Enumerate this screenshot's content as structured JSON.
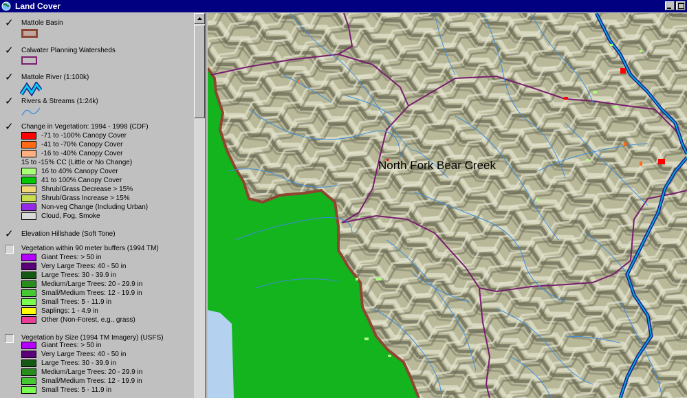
{
  "window": {
    "title": "Land Cover"
  },
  "toc": {
    "layers": [
      {
        "name": "Mattole Basin",
        "checked": true
      },
      {
        "name": "Calwater Planning Watersheds",
        "checked": true
      },
      {
        "name": "Mattole River (1:100k)",
        "checked": true
      },
      {
        "name": "Rivers & Streams (1:24k)",
        "checked": true
      },
      {
        "name": "Change in Vegetation: 1994 - 1998 (CDF)",
        "checked": true,
        "legend": [
          {
            "label": "-71 to -100% Canopy Cover",
            "color": "#ff0000"
          },
          {
            "label": "-41 to -70% Canopy Cover",
            "color": "#ff6a14"
          },
          {
            "label": "-16 to -40% Canopy Cover",
            "color": "#ffb080"
          },
          {
            "label": "15 to -15% CC (Little or No Change)",
            "color": null
          },
          {
            "label": "16 to 40% Canopy Cover",
            "color": "#a8ff78"
          },
          {
            "label": "41 to 100% Canopy Cover",
            "color": "#00c800"
          },
          {
            "label": "Shrub/Grass Decrease > 15%",
            "color": "#f0d878"
          },
          {
            "label": "Shrub/Grass Increase > 15%",
            "color": "#c8dc50"
          },
          {
            "label": "Non-veg Change (Including Urban)",
            "color": "#9628e8"
          },
          {
            "label": "Cloud, Fog, Smoke",
            "color": "#d8d8d8"
          }
        ]
      },
      {
        "name": "Elevation Hillshade (Soft Tone)",
        "checked": true
      },
      {
        "name": "Vegetation within 90 meter buffers (1994 TM)",
        "checked": false,
        "legend": [
          {
            "label": "Giant Trees: > 50 in",
            "color": "#b400ff"
          },
          {
            "label": "Very Large Trees: 40 - 50 in",
            "color": "#5a0078"
          },
          {
            "label": "Large Trees: 30 - 39.9 in",
            "color": "#145a14"
          },
          {
            "label": "Medium/Large Trees: 20 - 29.9 in",
            "color": "#288c1e"
          },
          {
            "label": "Small/Medium Trees: 12 - 19.9 in",
            "color": "#46c832"
          },
          {
            "label": "Small Trees: 5 - 11.9 in",
            "color": "#78ff50"
          },
          {
            "label": "Saplings: 1 - 4.9 in",
            "color": "#ffff00"
          },
          {
            "label": "Other (Non-Forest, e.g., grass)",
            "color": "#e83c96"
          }
        ]
      },
      {
        "name": "Vegetation by Size (1994 TM Imagery) (USFS)",
        "checked": false,
        "legend": [
          {
            "label": "Giant Trees: > 50 in",
            "color": "#b400ff"
          },
          {
            "label": "Very Large Trees: 40 - 50 in",
            "color": "#5a0078"
          },
          {
            "label": "Large Trees: 30 - 39.9 in",
            "color": "#145a14"
          },
          {
            "label": "Medium/Large Trees: 20 - 29.9 in",
            "color": "#288c1e"
          },
          {
            "label": "Small/Medium Trees: 12 - 19.9 in",
            "color": "#46c832"
          },
          {
            "label": "Small Trees: 5 - 11.9 in",
            "color": "#78ff50"
          }
        ]
      }
    ]
  },
  "map": {
    "label": "North Fork Bear Creek",
    "colors": {
      "terrain": "#b9b99a",
      "ocean_green": "#14b41e",
      "water": "#b4d2f0",
      "basin_outline": "#8c4632",
      "watershed_outline": "#781e6e",
      "streams": "#3c8cdc",
      "river": "#00aadc",
      "river_dark": "#1e1e8c"
    }
  }
}
